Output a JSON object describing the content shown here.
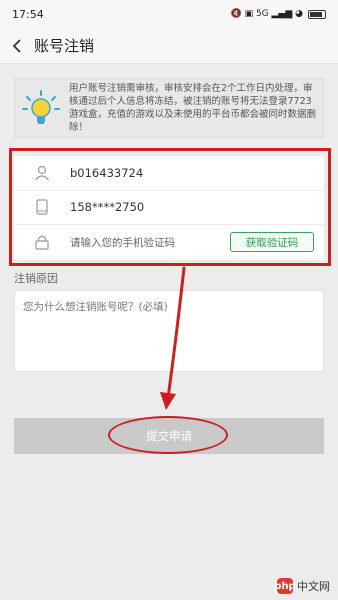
{
  "status_bar": {
    "time": "17:54",
    "indicators": "🔇 ▣ 5G ▂▄▆ ◕",
    "battery_icon": "battery-icon"
  },
  "nav": {
    "title": "账号注销",
    "back_icon": "back-arrow-icon"
  },
  "notice": {
    "icon": "lightbulb-icon",
    "text": "用户账号注销需审核，审核安排会在2个工作日内处理，审核通过后个人信息将冻结，被注销的账号将无法登录7723游戏盒，充值的游戏以及未使用的平台币都会被同时数据删除！"
  },
  "account_form": {
    "username": "b016433724",
    "phone": "158****2750",
    "code_placeholder": "请输入您的手机验证码",
    "get_code_button": "获取验证码"
  },
  "reason": {
    "label": "注销原因",
    "placeholder": "您为什么想注销账号呢？(必填)"
  },
  "submit_button": "提交申请",
  "watermark": {
    "logo": "php",
    "text": "中文网"
  },
  "colors": {
    "highlight_red": "#cc1f1f",
    "green_accent": "#2e9e4f",
    "submit_gray": "#c9c9c9"
  }
}
